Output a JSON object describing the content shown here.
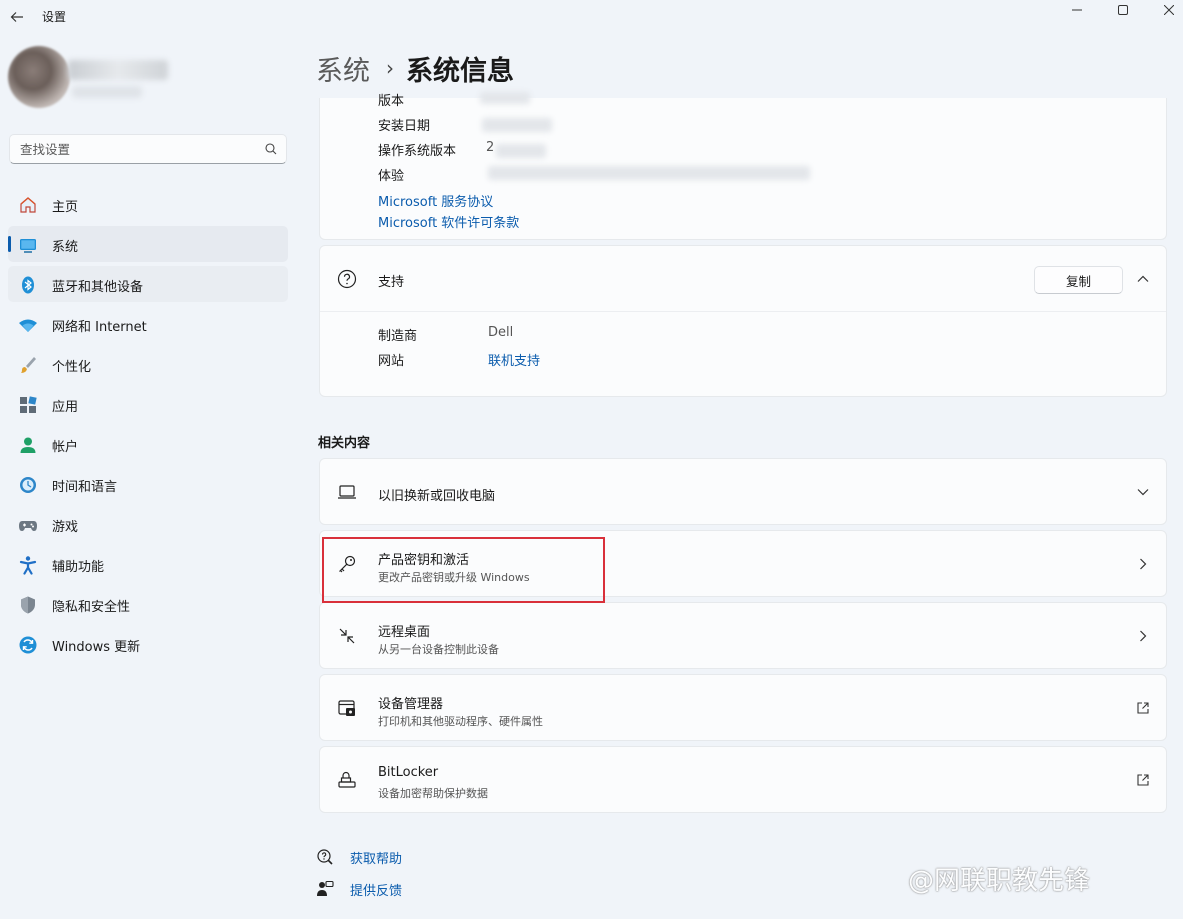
{
  "window": {
    "title": "设置"
  },
  "search": {
    "placeholder": "查找设置"
  },
  "sidebar": {
    "items": [
      {
        "label": "主页",
        "icon": "home-icon"
      },
      {
        "label": "系统",
        "icon": "system-icon"
      },
      {
        "label": "蓝牙和其他设备",
        "icon": "bluetooth-icon"
      },
      {
        "label": "网络和 Internet",
        "icon": "network-icon"
      },
      {
        "label": "个性化",
        "icon": "brush-icon"
      },
      {
        "label": "应用",
        "icon": "apps-icon"
      },
      {
        "label": "帐户",
        "icon": "account-icon"
      },
      {
        "label": "时间和语言",
        "icon": "time-language-icon"
      },
      {
        "label": "游戏",
        "icon": "gamepad-icon"
      },
      {
        "label": "辅助功能",
        "icon": "accessibility-icon"
      },
      {
        "label": "隐私和安全性",
        "icon": "shield-icon"
      },
      {
        "label": "Windows 更新",
        "icon": "windows-update-icon"
      }
    ]
  },
  "breadcrumb": {
    "parent": "系统",
    "separator": "›",
    "current": "系统信息"
  },
  "windows_spec": {
    "rows": [
      {
        "label": "版本",
        "value": ""
      },
      {
        "label": "安装日期",
        "value": ""
      },
      {
        "label": "操作系统版本",
        "value": "2"
      },
      {
        "label": "体验",
        "value": ""
      }
    ],
    "links": [
      "Microsoft 服务协议",
      "Microsoft 软件许可条款"
    ]
  },
  "support": {
    "title": "支持",
    "copy_label": "复制",
    "rows": [
      {
        "label": "制造商",
        "value": "Dell"
      },
      {
        "label": "网站",
        "value": "联机支持"
      }
    ]
  },
  "related": {
    "title": "相关内容",
    "items": [
      {
        "title": "以旧换新或回收电脑",
        "subtitle": "",
        "icon": "laptop-icon",
        "end": "chevron-down-icon"
      },
      {
        "title": "产品密钥和激活",
        "subtitle": "更改产品密钥或升级 Windows",
        "icon": "key-icon",
        "end": "chevron-right-icon"
      },
      {
        "title": "远程桌面",
        "subtitle": "从另一台设备控制此设备",
        "icon": "remote-desktop-icon",
        "end": "chevron-right-icon"
      },
      {
        "title": "设备管理器",
        "subtitle": "打印机和其他驱动程序、硬件属性",
        "icon": "device-manager-icon",
        "end": "external-link-icon"
      },
      {
        "title": "BitLocker",
        "subtitle": "设备加密帮助保护数据",
        "icon": "bitlocker-icon",
        "end": "external-link-icon"
      }
    ]
  },
  "help": {
    "get_help": "获取帮助",
    "feedback": "提供反馈"
  },
  "watermark": {
    "text": "@网联职教先锋"
  },
  "colors": {
    "accent": "#0b5cad",
    "highlight": "#d9303a",
    "background": "#f0f4f9",
    "card": "#fbfcfd"
  }
}
